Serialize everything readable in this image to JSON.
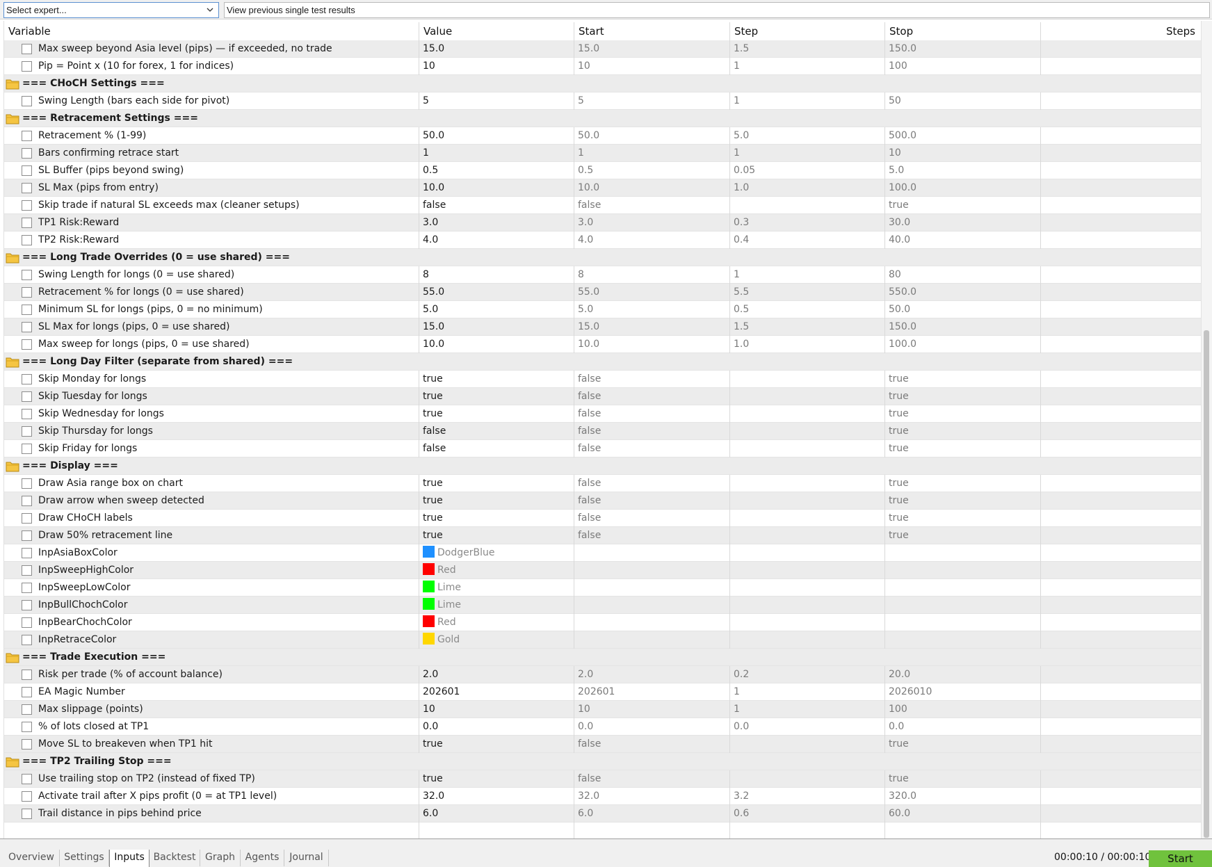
{
  "topbar": {
    "expert_select_value": "Select expert...",
    "previous_results_label": "View previous single test results"
  },
  "columns": {
    "variable": "Variable",
    "value": "Value",
    "start": "Start",
    "step": "Step",
    "stop": "Stop",
    "steps": "Steps"
  },
  "colors": {
    "DodgerBlue": "#1e90ff",
    "Red": "#ff0000",
    "Lime": "#00ff00",
    "Gold": "#ffd700",
    "start_button": "#70c23d",
    "folder": "#f5c542",
    "row_shade": "#ececec"
  },
  "rows": [
    {
      "type": "param",
      "name": "Max sweep beyond Asia level (pips) — if exceeded, no trade",
      "value": "15.0",
      "start": "15.0",
      "step": "1.5",
      "stop": "150.0"
    },
    {
      "type": "param",
      "name": "Pip = Point x (10 for forex, 1 for indices)",
      "value": "10",
      "start": "10",
      "step": "1",
      "stop": "100"
    },
    {
      "type": "group",
      "title": "=== CHoCH Settings ==="
    },
    {
      "type": "param",
      "name": "Swing Length (bars each side for pivot)",
      "value": "5",
      "start": "5",
      "step": "1",
      "stop": "50"
    },
    {
      "type": "group",
      "title": "=== Retracement Settings ==="
    },
    {
      "type": "param",
      "name": "Retracement % (1-99)",
      "value": "50.0",
      "start": "50.0",
      "step": "5.0",
      "stop": "500.0"
    },
    {
      "type": "param",
      "name": "Bars confirming retrace start",
      "value": "1",
      "start": "1",
      "step": "1",
      "stop": "10"
    },
    {
      "type": "param",
      "name": "SL Buffer (pips beyond swing)",
      "value": "0.5",
      "start": "0.5",
      "step": "0.05",
      "stop": "5.0"
    },
    {
      "type": "param",
      "name": "SL Max (pips from entry)",
      "value": "10.0",
      "start": "10.0",
      "step": "1.0",
      "stop": "100.0"
    },
    {
      "type": "param",
      "name": "Skip trade if natural SL exceeds max (cleaner setups)",
      "value": "false",
      "start": "false",
      "step": "",
      "stop": "true"
    },
    {
      "type": "param",
      "name": "TP1 Risk:Reward",
      "value": "3.0",
      "start": "3.0",
      "step": "0.3",
      "stop": "30.0"
    },
    {
      "type": "param",
      "name": "TP2 Risk:Reward",
      "value": "4.0",
      "start": "4.0",
      "step": "0.4",
      "stop": "40.0"
    },
    {
      "type": "group",
      "title": "=== Long Trade Overrides (0 = use shared) ==="
    },
    {
      "type": "param",
      "name": "Swing Length for longs (0 = use shared)",
      "value": "8",
      "start": "8",
      "step": "1",
      "stop": "80"
    },
    {
      "type": "param",
      "name": "Retracement % for longs (0 = use shared)",
      "value": "55.0",
      "start": "55.0",
      "step": "5.5",
      "stop": "550.0"
    },
    {
      "type": "param",
      "name": "Minimum SL for longs (pips, 0 = no minimum)",
      "value": "5.0",
      "start": "5.0",
      "step": "0.5",
      "stop": "50.0"
    },
    {
      "type": "param",
      "name": "SL Max for longs (pips, 0 = use shared)",
      "value": "15.0",
      "start": "15.0",
      "step": "1.5",
      "stop": "150.0"
    },
    {
      "type": "param",
      "name": "Max sweep for longs (pips, 0 = use shared)",
      "value": "10.0",
      "start": "10.0",
      "step": "1.0",
      "stop": "100.0"
    },
    {
      "type": "group",
      "title": "=== Long Day Filter (separate from shared) ==="
    },
    {
      "type": "param",
      "name": "Skip Monday for longs",
      "value": "true",
      "start": "false",
      "step": "",
      "stop": "true"
    },
    {
      "type": "param",
      "name": "Skip Tuesday for longs",
      "value": "true",
      "start": "false",
      "step": "",
      "stop": "true"
    },
    {
      "type": "param",
      "name": "Skip Wednesday for longs",
      "value": "true",
      "start": "false",
      "step": "",
      "stop": "true"
    },
    {
      "type": "param",
      "name": "Skip Thursday for longs",
      "value": "false",
      "start": "false",
      "step": "",
      "stop": "true"
    },
    {
      "type": "param",
      "name": "Skip Friday for longs",
      "value": "false",
      "start": "false",
      "step": "",
      "stop": "true"
    },
    {
      "type": "group",
      "title": "=== Display ==="
    },
    {
      "type": "param",
      "name": "Draw Asia range box on chart",
      "value": "true",
      "start": "false",
      "step": "",
      "stop": "true"
    },
    {
      "type": "param",
      "name": "Draw arrow when sweep detected",
      "value": "true",
      "start": "false",
      "step": "",
      "stop": "true"
    },
    {
      "type": "param",
      "name": "Draw CHoCH labels",
      "value": "true",
      "start": "false",
      "step": "",
      "stop": "true"
    },
    {
      "type": "param",
      "name": "Draw 50% retracement line",
      "value": "true",
      "start": "false",
      "step": "",
      "stop": "true"
    },
    {
      "type": "color",
      "name": "InpAsiaBoxColor",
      "color_name": "DodgerBlue"
    },
    {
      "type": "color",
      "name": "InpSweepHighColor",
      "color_name": "Red"
    },
    {
      "type": "color",
      "name": "InpSweepLowColor",
      "color_name": "Lime"
    },
    {
      "type": "color",
      "name": "InpBullChochColor",
      "color_name": "Lime"
    },
    {
      "type": "color",
      "name": "InpBearChochColor",
      "color_name": "Red"
    },
    {
      "type": "color",
      "name": "InpRetraceColor",
      "color_name": "Gold"
    },
    {
      "type": "group",
      "title": "=== Trade Execution ==="
    },
    {
      "type": "param",
      "name": "Risk per trade (% of account balance)",
      "value": "2.0",
      "start": "2.0",
      "step": "0.2",
      "stop": "20.0"
    },
    {
      "type": "param",
      "name": "EA Magic Number",
      "value": "202601",
      "start": "202601",
      "step": "1",
      "stop": "2026010"
    },
    {
      "type": "param",
      "name": "Max slippage (points)",
      "value": "10",
      "start": "10",
      "step": "1",
      "stop": "100"
    },
    {
      "type": "param",
      "name": "% of lots closed at TP1",
      "value": "0.0",
      "start": "0.0",
      "step": "0.0",
      "stop": "0.0"
    },
    {
      "type": "param",
      "name": "Move SL to breakeven when TP1 hit",
      "value": "true",
      "start": "false",
      "step": "",
      "stop": "true"
    },
    {
      "type": "group",
      "title": "=== TP2 Trailing Stop ==="
    },
    {
      "type": "param",
      "name": "Use trailing stop on TP2 (instead of fixed TP)",
      "value": "true",
      "start": "false",
      "step": "",
      "stop": "true"
    },
    {
      "type": "param",
      "name": "Activate trail after X pips profit (0 = at TP1 level)",
      "value": "32.0",
      "start": "32.0",
      "step": "3.2",
      "stop": "320.0"
    },
    {
      "type": "param",
      "name": "Trail distance in pips behind price",
      "value": "6.0",
      "start": "6.0",
      "step": "0.6",
      "stop": "60.0"
    }
  ],
  "tabs": [
    "Overview",
    "Settings",
    "Inputs",
    "Backtest",
    "Graph",
    "Agents",
    "Journal"
  ],
  "active_tab": "Inputs",
  "timer": "00:00:10 / 00:00:10",
  "start_button": "Start"
}
